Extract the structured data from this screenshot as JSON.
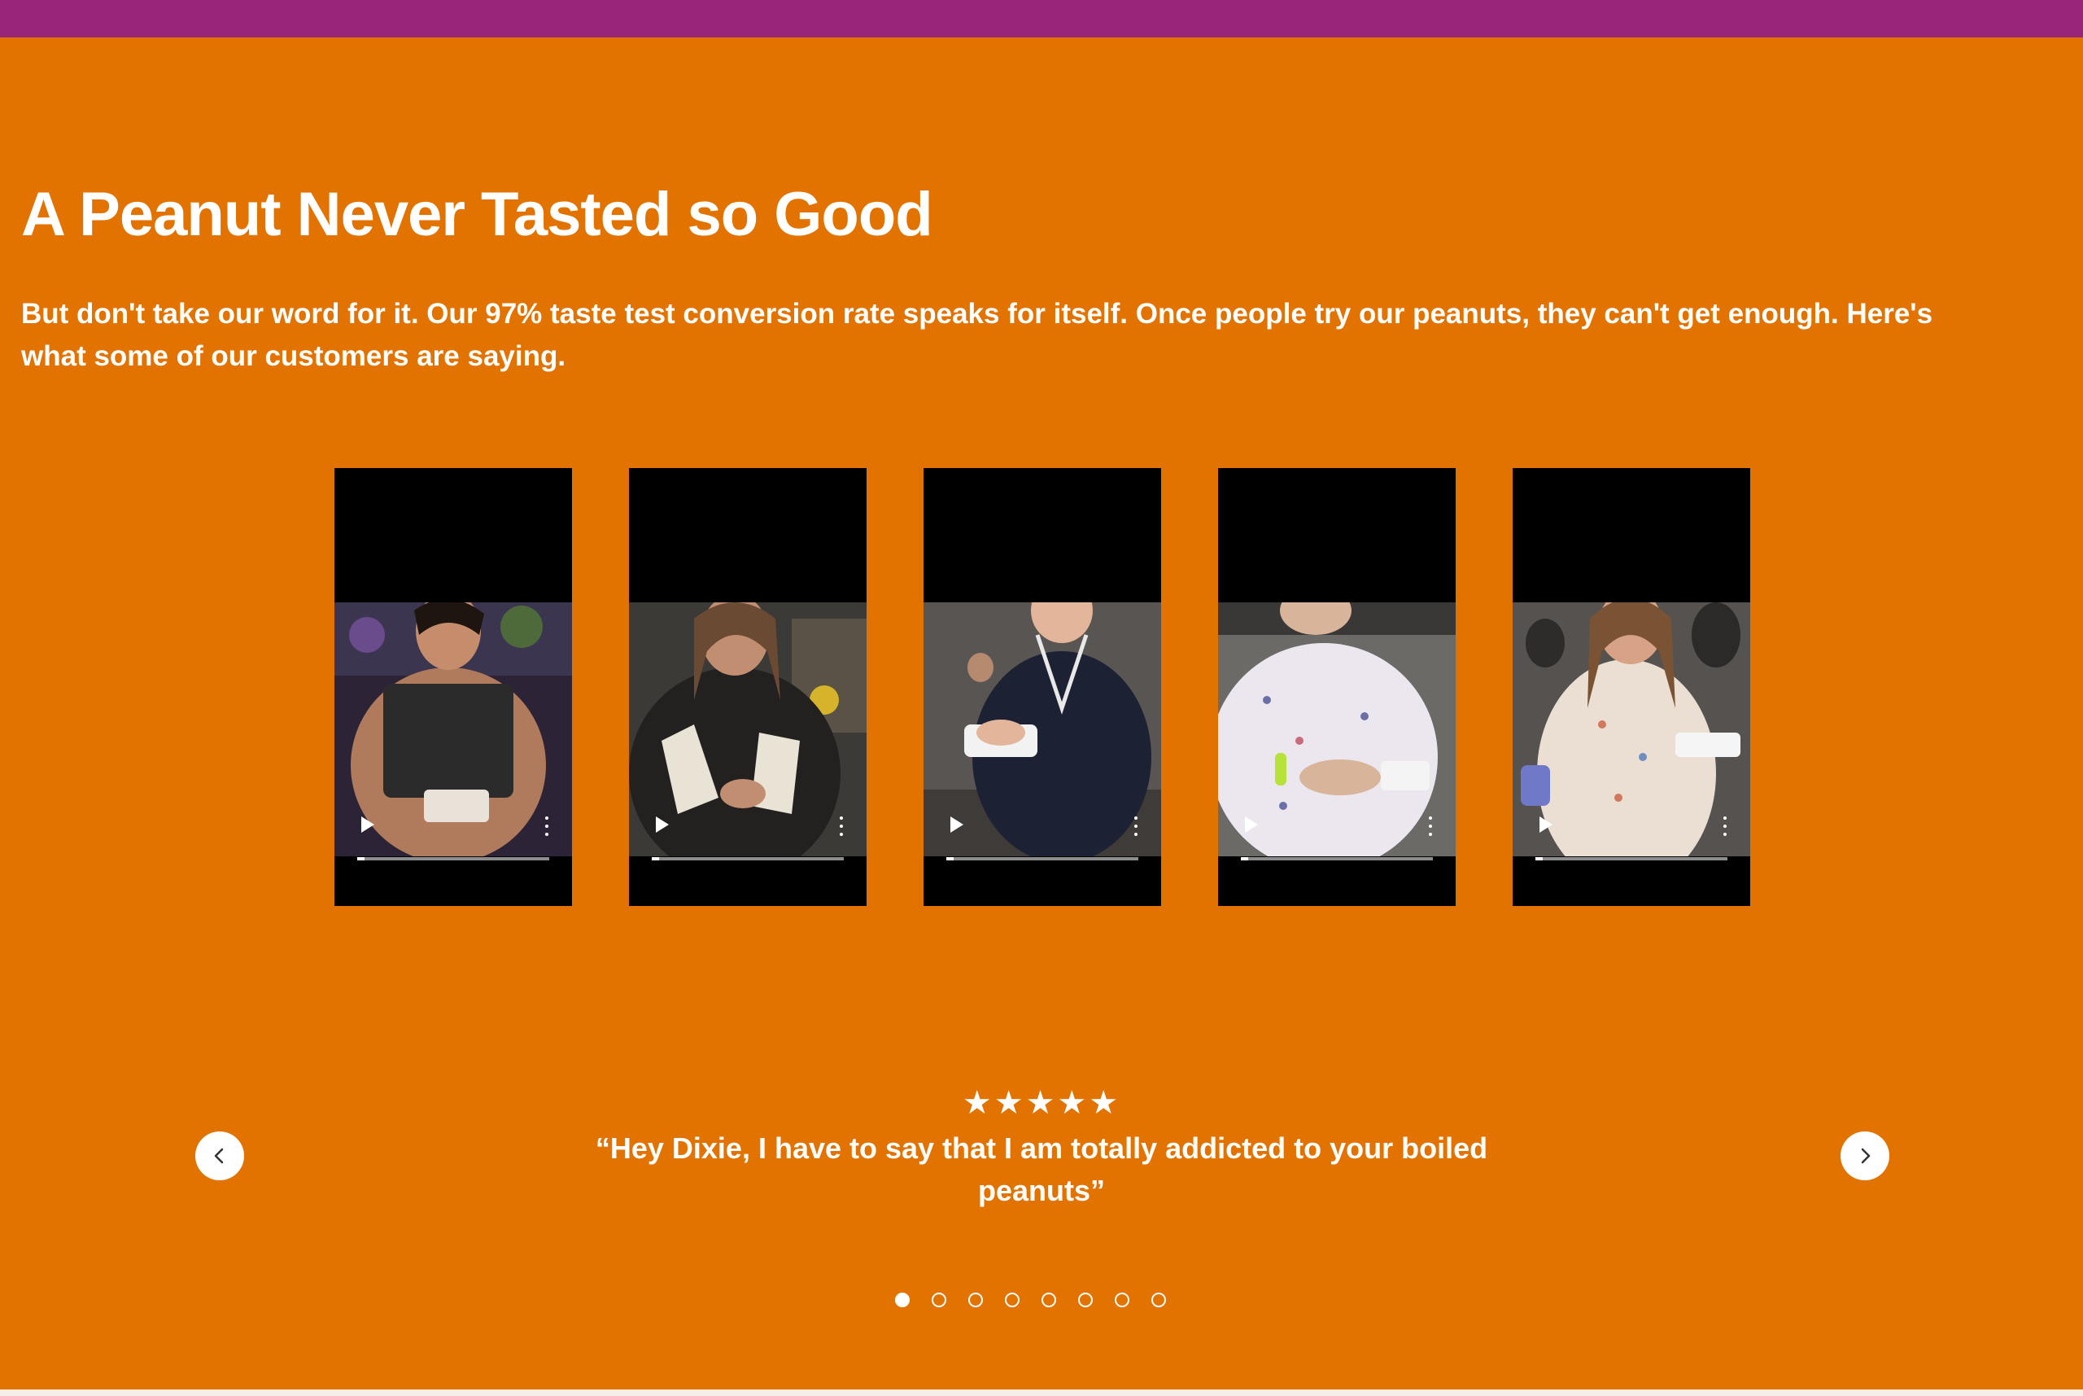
{
  "section": {
    "title": "A Peanut Never Tasted so Good",
    "intro": "But don't take our word for it. Our 97% taste test conversion rate speaks for itself. Once people try our peanuts, they can't get enough. Here's what some of our customers are saying."
  },
  "videos": [
    {
      "name": "video-1"
    },
    {
      "name": "video-2"
    },
    {
      "name": "video-3"
    },
    {
      "name": "video-4"
    },
    {
      "name": "video-5"
    }
  ],
  "testimonial": {
    "rating": 5,
    "stars": "★★★★★",
    "quote": "“Hey Dixie, I have to say that I am totally addicted to your boiled peanuts”"
  },
  "carousel": {
    "slide_count": 8,
    "active_index": 0,
    "prev_icon": "chevron-left-icon",
    "next_icon": "chevron-right-icon"
  },
  "colors": {
    "background": "#E37300",
    "top_bar": "#98257A",
    "text": "#FFFFFF"
  }
}
